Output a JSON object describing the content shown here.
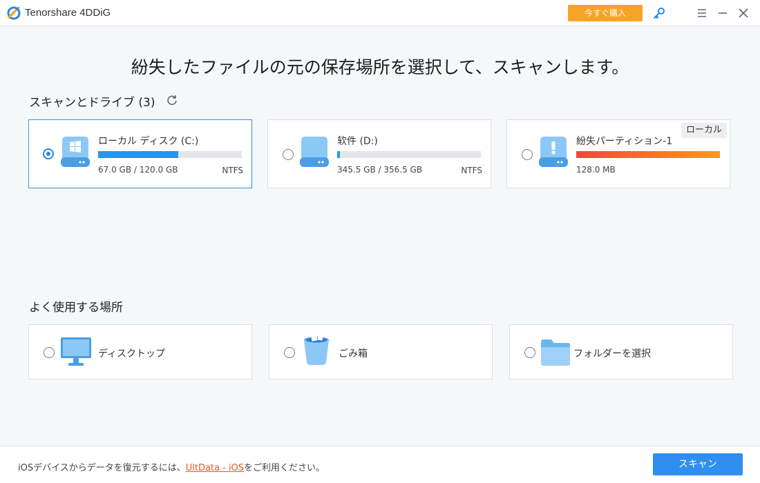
{
  "window": {
    "title": "Tenorshare 4DDiG",
    "buy_label": "今すぐ購入"
  },
  "main": {
    "heading": "紛失したファイルの元の保存場所を選択して、スキャンします。"
  },
  "drives_section": {
    "title": "スキャンとドライブ (3)",
    "drives": [
      {
        "name": "ローカル ディスク (C:)",
        "size": "67.0 GB / 120.0 GB",
        "fs": "NTFS",
        "used_fraction": 0.56,
        "selected": true,
        "icon": "windows-drive-icon"
      },
      {
        "name": "软件 (D:)",
        "size": "345.5 GB / 356.5 GB",
        "fs": "NTFS",
        "used_fraction": 0.02,
        "selected": false,
        "icon": "drive-icon"
      },
      {
        "name": "紛失パーティション-1",
        "size": "128.0 MB",
        "fs": "",
        "used_fraction": 1.0,
        "selected": false,
        "badge": "ローカル",
        "icon": "lost-partition-icon"
      }
    ]
  },
  "locations_section": {
    "title": "よく使用する場所",
    "items": [
      {
        "label": "ディスクトップ",
        "icon": "monitor-icon"
      },
      {
        "label": "ごみ箱",
        "icon": "trash-icon"
      },
      {
        "label": "フォルダーを選択",
        "icon": "folder-icon"
      }
    ]
  },
  "footer": {
    "text_before": "iOSデバイスからデータを復元するには、",
    "link": "UltData - iOS",
    "text_after": "をご利用ください。",
    "scan_label": "スキャン"
  },
  "colors": {
    "accent": "#2f8ff0",
    "buy": "#f7a325",
    "link": "#e8571c"
  }
}
